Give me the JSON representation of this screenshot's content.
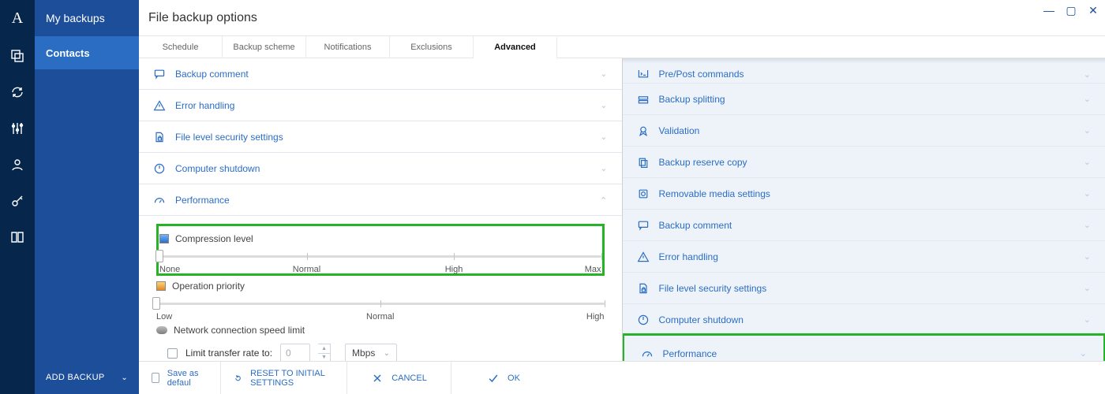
{
  "rail": {
    "brand": "A"
  },
  "leftcol": {
    "title": "My backups",
    "active": "Contacts",
    "add": "ADD BACKUP"
  },
  "window": {
    "title": "File backup options"
  },
  "tabs": [
    "Schedule",
    "Backup scheme",
    "Notifications",
    "Exclusions",
    "Advanced"
  ],
  "active_tab": 4,
  "acc_left": [
    {
      "key": "comment",
      "label": "Backup comment",
      "icon": "comment"
    },
    {
      "key": "error",
      "label": "Error handling",
      "icon": "warning"
    },
    {
      "key": "security",
      "label": "File level security settings",
      "icon": "file-lock"
    },
    {
      "key": "shutdown",
      "label": "Computer shutdown",
      "icon": "power"
    },
    {
      "key": "performance",
      "label": "Performance",
      "icon": "gauge",
      "open": true
    }
  ],
  "performance": {
    "compression": {
      "title": "Compression level",
      "legend": [
        "None",
        "Normal",
        "High",
        "Max"
      ],
      "value_index": 0
    },
    "priority": {
      "title": "Operation priority",
      "legend": [
        "Low",
        "Normal",
        "High"
      ],
      "value_index": 0
    },
    "network": {
      "title": "Network connection speed limit",
      "checkbox_label": "Limit transfer rate to:",
      "value": "0",
      "unit": "Mbps"
    }
  },
  "acc_right_clipped": {
    "label": "Pre/Post commands",
    "icon": "terminal"
  },
  "acc_right": [
    {
      "key": "splitting",
      "label": "Backup splitting",
      "icon": "split"
    },
    {
      "key": "validation",
      "label": "Validation",
      "icon": "ribbon"
    },
    {
      "key": "reserve",
      "label": "Backup reserve copy",
      "icon": "copy"
    },
    {
      "key": "removable",
      "label": "Removable media settings",
      "icon": "disk"
    },
    {
      "key": "comment2",
      "label": "Backup comment",
      "icon": "comment"
    },
    {
      "key": "error2",
      "label": "Error handling",
      "icon": "warning"
    },
    {
      "key": "security2",
      "label": "File level security settings",
      "icon": "file-lock"
    },
    {
      "key": "shutdown2",
      "label": "Computer shutdown",
      "icon": "power"
    },
    {
      "key": "performance2",
      "label": "Performance",
      "icon": "gauge",
      "highlight": true
    }
  ],
  "footer": {
    "save_default": "Save as defaul",
    "reset": "RESET TO INITIAL SETTINGS",
    "cancel": "CANCEL",
    "ok": "OK"
  }
}
